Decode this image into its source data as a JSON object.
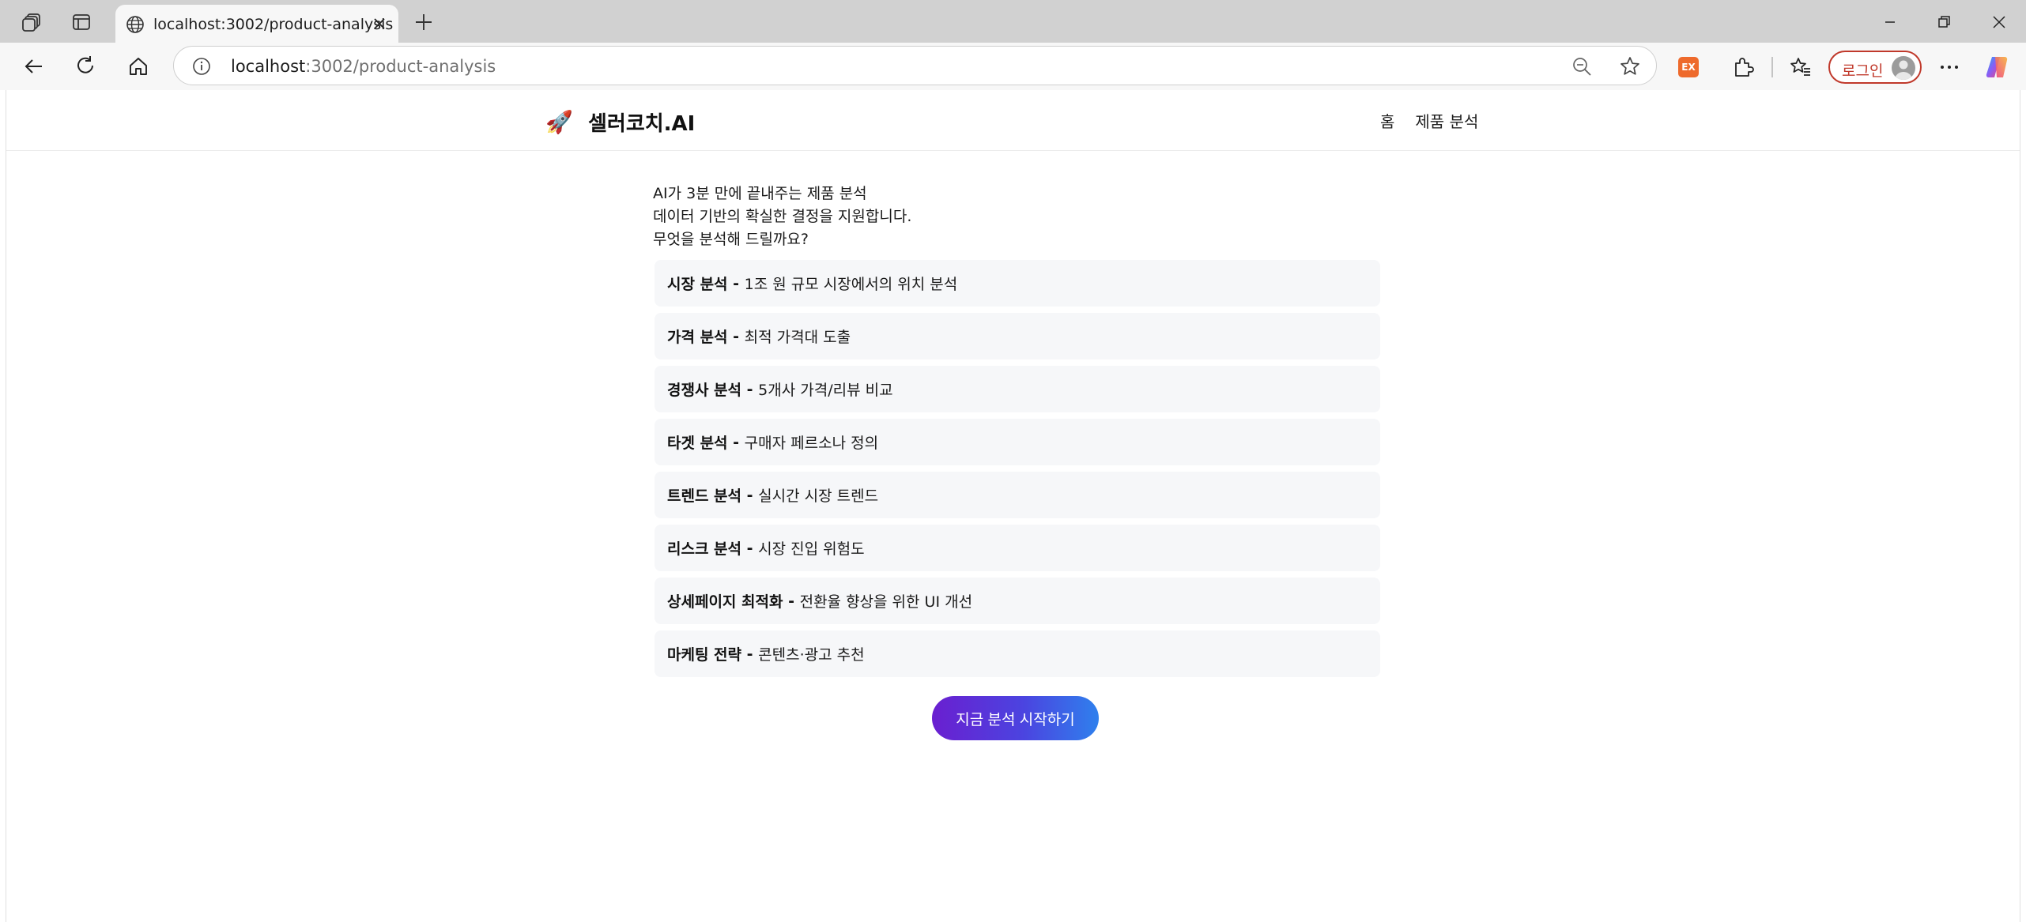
{
  "browser": {
    "tab_title": "localhost:3002/product-analysis",
    "url_host": "localhost",
    "url_path": ":3002/product-analysis",
    "extension_badge": "EX",
    "login_label": "로그인",
    "accent_login": "#c0392b"
  },
  "site": {
    "brand_icon": "🚀",
    "brand_name": "셀러코치.AI",
    "nav": {
      "home": "홈",
      "product_analysis": "제품 분석"
    }
  },
  "intro": {
    "line1": "AI가 3분 만에 끝내주는 제품 분석",
    "line2": "데이터 기반의 확실한 결정을 지원합니다.",
    "line3": "무엇을 분석해 드릴까요?"
  },
  "features": [
    {
      "title": "시장 분석",
      "desc": "1조 원 규모 시장에서의 위치 분석"
    },
    {
      "title": "가격 분석",
      "desc": "최적 가격대 도출"
    },
    {
      "title": "경쟁사 분석",
      "desc": "5개사 가격/리뷰 비교"
    },
    {
      "title": "타겟 분석",
      "desc": "구매자 페르소나 정의"
    },
    {
      "title": "트렌드 분석",
      "desc": "실시간 시장 트렌드"
    },
    {
      "title": "리스크 분석",
      "desc": "시장 진입 위험도"
    },
    {
      "title": "상세페이지 최적화",
      "desc": "전환율 향상을 위한 UI 개선"
    },
    {
      "title": "마케팅 전략",
      "desc": "콘텐츠·광고 추천"
    }
  ],
  "cta_label": "지금 분석 시작하기",
  "colors": {
    "cta_gradient_start": "#6a1fd0",
    "cta_gradient_end": "#2f80ed",
    "card_bg": "#f6f7f9"
  }
}
